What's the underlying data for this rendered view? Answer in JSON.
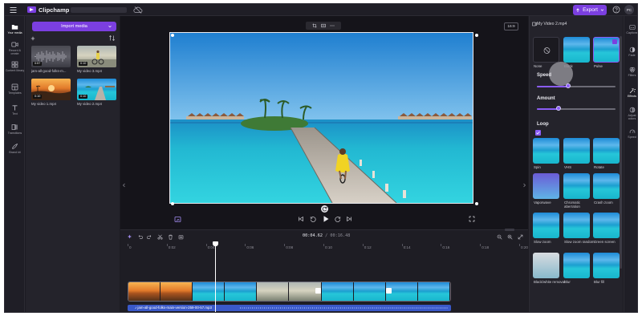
{
  "app": {
    "name": "Clipchamp"
  },
  "topbar": {
    "export_label": "Export",
    "avatar_initials": "PC"
  },
  "left_nav": {
    "items": [
      {
        "label": "Your media",
        "active": true
      },
      {
        "label": "Record & create"
      },
      {
        "label": "Content library"
      },
      {
        "label": "Templates"
      },
      {
        "label": "Text"
      },
      {
        "label": "Transitions"
      },
      {
        "label": "Brand kit"
      }
    ]
  },
  "media": {
    "import_label": "Import media",
    "items": [
      {
        "label": "jam-all-good-folks-m...",
        "duration": "0:57"
      },
      {
        "label": "My video 3.mp4",
        "duration": "0:10"
      },
      {
        "label": "My video 1.mp4",
        "duration": "0:10"
      },
      {
        "label": "My video 2.mp4",
        "duration": "0:10"
      }
    ]
  },
  "preview": {
    "aspect_ratio": "16:9"
  },
  "timeline": {
    "current_time": "00:04.62",
    "separator": " / ",
    "total_time": "00:16.48",
    "ticks": [
      "0",
      "0:02",
      "0:04",
      "0:06",
      "0:08",
      "0:10",
      "0:12",
      "0:14",
      "0:16",
      "0:18",
      "0:20"
    ],
    "audio_label": "jam-all-good-folks-main-version-259-00-57.mp3"
  },
  "effects_panel": {
    "title": "My Video 2.mp4",
    "top_effects": [
      {
        "label": "None"
      },
      {
        "label": "Black"
      },
      {
        "label": "Pulse",
        "selected": true
      }
    ],
    "speed_label": "Speed",
    "speed_value": 0.4,
    "amount_label": "Amount",
    "amount_value": 0.28,
    "loop_label": "Loop",
    "loop_checked": true,
    "effects": [
      {
        "label": "Spin"
      },
      {
        "label": "VHS"
      },
      {
        "label": "Rotate"
      },
      {
        "label": "Vaporwave"
      },
      {
        "label": "Chromatic aberration"
      },
      {
        "label": "Crash zoom"
      },
      {
        "label": "Slow zoom"
      },
      {
        "label": "Slow zoom random"
      },
      {
        "label": "Green screen"
      },
      {
        "label": "Black/white removal"
      },
      {
        "label": "Blur"
      },
      {
        "label": "Blur fill"
      }
    ]
  },
  "right_rail": {
    "items": [
      {
        "label": "Captions"
      },
      {
        "label": "Fade"
      },
      {
        "label": "Filters"
      },
      {
        "label": "Effects",
        "active": true
      },
      {
        "label": "Adjust colors"
      },
      {
        "label": "Speed"
      }
    ]
  },
  "colors": {
    "accent": "#7b3fe0",
    "background": "#1c1b22",
    "audio": "#3a59c9"
  }
}
